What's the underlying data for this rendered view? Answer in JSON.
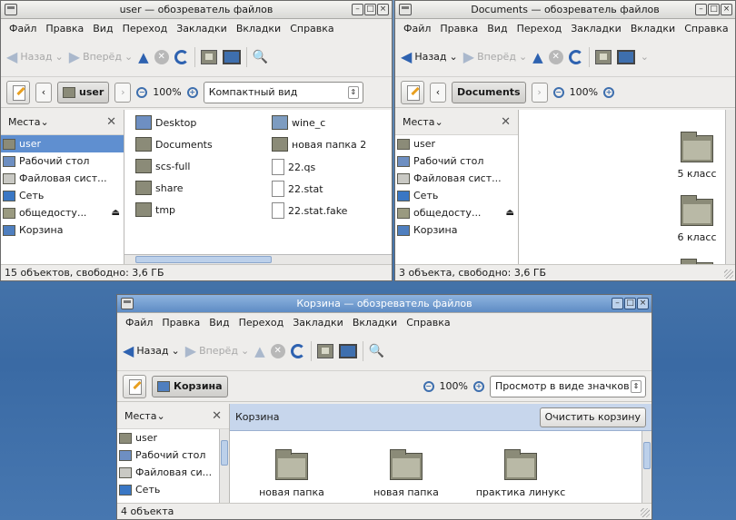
{
  "windows": {
    "user": {
      "title": "user — обозреватель файлов",
      "menu": [
        "Файл",
        "Правка",
        "Вид",
        "Переход",
        "Закладки",
        "Вкладки",
        "Справка"
      ],
      "nav": {
        "back": "Назад",
        "forward": "Вперёд"
      },
      "path": "user",
      "zoom": "100%",
      "view": "Компактный вид",
      "sidebar": {
        "title": "Места",
        "items": [
          "user",
          "Рабочий стол",
          "Файловая сист...",
          "Сеть",
          "общедосту...",
          "Корзина"
        ]
      },
      "files_col1": [
        "Desktop",
        "Documents",
        "scs-full",
        "share",
        "tmp"
      ],
      "files_col2": [
        "wine_c",
        "новая папка 2",
        "22.qs",
        "22.stat",
        "22.stat.fake"
      ],
      "status": "15 объектов, свободно: 3,6 ГБ"
    },
    "documents": {
      "title": "Documents — обозреватель файлов",
      "menu": [
        "Файл",
        "Правка",
        "Вид",
        "Переход",
        "Закладки",
        "Вкладки",
        "Справка"
      ],
      "nav": {
        "back": "Назад",
        "forward": "Вперёд"
      },
      "path": "Documents",
      "zoom": "100%",
      "sidebar": {
        "title": "Места",
        "items": [
          "user",
          "Рабочий стол",
          "Файловая сист...",
          "Сеть",
          "общедосту...",
          "Корзина"
        ]
      },
      "files": [
        "5 класс",
        "6 класс"
      ],
      "status": "3 объекта, свободно: 3,6 ГБ"
    },
    "trash": {
      "title": "Корзина — обозреватель файлов",
      "menu": [
        "Файл",
        "Правка",
        "Вид",
        "Переход",
        "Закладки",
        "Вкладки",
        "Справка"
      ],
      "nav": {
        "back": "Назад",
        "forward": "Вперёд"
      },
      "path": "Корзина",
      "zoom": "100%",
      "view": "Просмотр в виде значков",
      "sidebar": {
        "title": "Места",
        "items": [
          "user",
          "Рабочий стол",
          "Файловая си...",
          "Сеть"
        ]
      },
      "bar_title": "Корзина",
      "empty_button": "Очистить корзину",
      "files": [
        "новая папка",
        "новая папка",
        "практика линукс"
      ],
      "status": "4 объекта"
    }
  },
  "icons": {
    "folder": "folder-icon",
    "desktop": "desktop-icon",
    "drive": "drive-icon",
    "network": "network-icon",
    "trash": "trash-icon",
    "document": "document-icon"
  }
}
